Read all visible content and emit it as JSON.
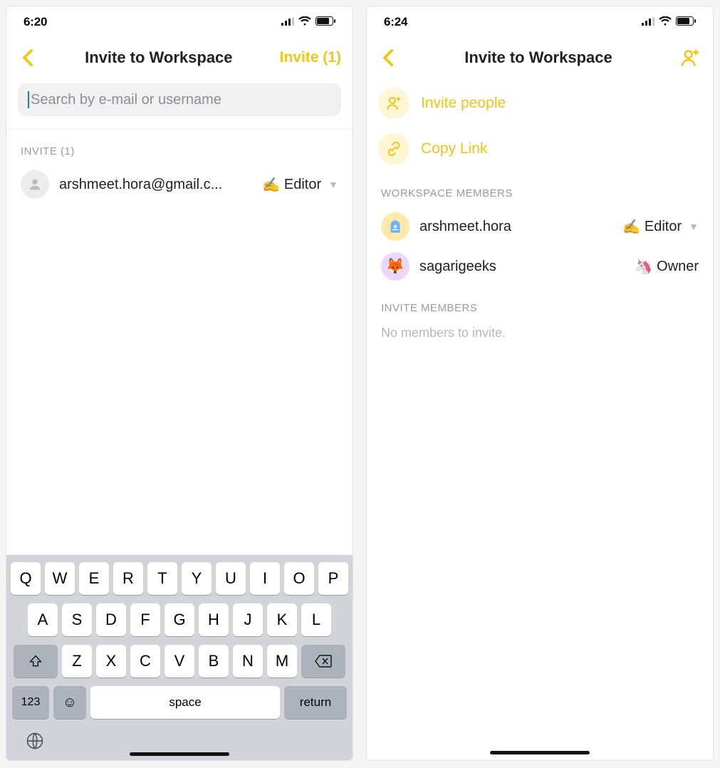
{
  "colors": {
    "accent": "#f5c518"
  },
  "screen1": {
    "status": {
      "time": "6:20"
    },
    "nav": {
      "title": "Invite to Workspace",
      "action": "Invite (1)"
    },
    "search": {
      "placeholder": "Search by e-mail or username"
    },
    "inviteSection": {
      "header": "INVITE (1)",
      "items": [
        {
          "email": "arshmeet.hora@gmail.c...",
          "roleIcon": "✍️",
          "roleLabel": "Editor"
        }
      ]
    },
    "keyboard": {
      "row1": [
        "Q",
        "W",
        "E",
        "R",
        "T",
        "Y",
        "U",
        "I",
        "O",
        "P"
      ],
      "row2": [
        "A",
        "S",
        "D",
        "F",
        "G",
        "H",
        "J",
        "K",
        "L"
      ],
      "row3": [
        "Z",
        "X",
        "C",
        "V",
        "B",
        "N",
        "M"
      ],
      "num": "123",
      "space": "space",
      "return": "return"
    }
  },
  "screen2": {
    "status": {
      "time": "6:24"
    },
    "nav": {
      "title": "Invite to Workspace"
    },
    "actions": [
      {
        "icon": "person-plus",
        "label": "Invite people"
      },
      {
        "icon": "link",
        "label": "Copy Link"
      }
    ],
    "membersHeader": "WORKSPACE MEMBERS",
    "members": [
      {
        "name": "arshmeet.hora",
        "roleIcon": "✍️",
        "roleLabel": "Editor",
        "roleChangeable": true,
        "avatar": "arsh"
      },
      {
        "name": "sagarigeeks",
        "roleIcon": "🦄",
        "roleLabel": "Owner",
        "roleChangeable": false,
        "avatar": "sag"
      }
    ],
    "inviteHeader": "INVITE MEMBERS",
    "inviteEmpty": "No members to invite."
  }
}
